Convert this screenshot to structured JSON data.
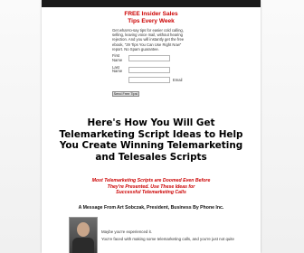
{
  "optin": {
    "heading_line1": "FREE Insider Sales",
    "heading_line2": "Tips Every Week",
    "body": "Get what-to-say tips for easier cold calling, selling, leaving voice mail, without hearing rejection. And you will instantly get the free ebook, \"29 Tips You Can Use Right Now\" report. No Spam guarantee.",
    "first_name_label": "First Name",
    "last_name_label": "Last Name",
    "email_label": "Email",
    "first_name_value": "",
    "last_name_value": "",
    "email_value": "",
    "submit_label": "Send Free Tips!"
  },
  "headline": "Here's How You Will Get Telemarketing Script Ideas to Help You Create Winning Telemarketing and Telesales Scripts",
  "subhead_line1": "Most Telemarketing Scripts are Doomed Even Before",
  "subhead_line2": "They're Presented. Use These Ideas for",
  "subhead_line3": "Successful Telemarketing Calls",
  "byline": "A Message From Art Sobczak, President, Business By Phone Inc.",
  "letter": {
    "line1": "Maybe you're experienced it.",
    "line2": "You're faced with making some telemarketing calls, and you're just not quite"
  },
  "colors": {
    "accent_red": "#cc0000",
    "top_bar": "#1a1a1a"
  }
}
